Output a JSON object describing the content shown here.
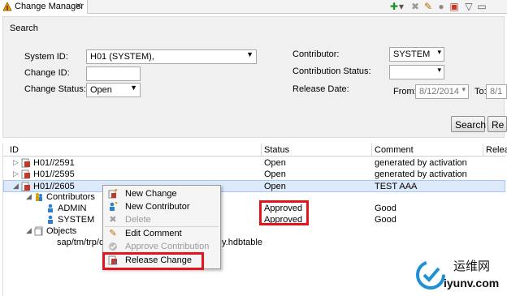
{
  "tab": {
    "title": "Change Manager",
    "close_glyph": "✕"
  },
  "toolbar": [
    {
      "name": "add-icon",
      "glyph": "✚",
      "color": "#1e8f2a"
    },
    {
      "name": "dropdown-icon",
      "glyph": "▾",
      "color": "#555"
    },
    {
      "name": "delete-icon",
      "glyph": "✖",
      "color": "#9a9a9a"
    },
    {
      "name": "edit-icon",
      "glyph": "✎",
      "color": "#b36b00"
    },
    {
      "name": "approve-icon",
      "glyph": "●",
      "color": "#8c8c8c"
    },
    {
      "name": "release-icon",
      "glyph": "▣",
      "color": "#c0392b"
    },
    {
      "name": "view-menu-icon",
      "glyph": "▽",
      "color": "#555"
    },
    {
      "name": "minimize-icon",
      "glyph": "▭",
      "color": "#555"
    }
  ],
  "search": {
    "title": "Search",
    "system_id_label": "System ID:",
    "system_id_value": "H01 (SYSTEM),",
    "change_id_label": "Change ID:",
    "change_id_value": "",
    "change_status_label": "Change Status:",
    "change_status_value": "Open",
    "contributor_label": "Contributor:",
    "contributor_value": "SYSTEM",
    "contribution_status_label": "Contribution Status:",
    "contribution_status_value": "",
    "release_date_label": "Release Date:",
    "from_label": "From:",
    "from_value": "8/12/2014",
    "to_label": "To:",
    "to_value": "8/1",
    "search_button": "Search",
    "reset_button": "Re"
  },
  "table": {
    "columns": [
      "ID",
      "Status",
      "Comment",
      "Relea"
    ],
    "rows": [
      {
        "id": "H01//2591",
        "status": "Open",
        "comment": "generated by activation"
      },
      {
        "id": "H01//2595",
        "status": "Open",
        "comment": "generated by activation"
      },
      {
        "id": "H01//2605",
        "status": "Open",
        "comment": "TEST AAA"
      }
    ],
    "contributors_label": "Contributors",
    "contributors": [
      {
        "name": "ADMIN",
        "status": "Approved",
        "comment": "Good"
      },
      {
        "name": "SYSTEM",
        "status": "Approved",
        "comment": "Good"
      }
    ],
    "objects_label": "Objects",
    "object_prefix": "sap/tm/trp/db",
    "object_suffix": "y.hdbtable"
  },
  "menu": {
    "items": [
      {
        "label": "New Change",
        "enabled": true,
        "icon": "new-change-icon"
      },
      {
        "label": "New Contributor",
        "enabled": true,
        "icon": "new-contributor-icon"
      },
      {
        "label": "Delete",
        "enabled": false,
        "icon": "delete-icon"
      },
      {
        "label": "Edit Comment",
        "enabled": true,
        "icon": "edit-comment-icon"
      },
      {
        "label": "Approve Contribution",
        "enabled": false,
        "icon": "approve-icon"
      },
      {
        "label": "Release Change",
        "enabled": true,
        "icon": "release-change-icon"
      }
    ]
  },
  "watermark": {
    "cn": "运维网",
    "url": "iyunv.com"
  },
  "colors": {
    "highlight_red": "#e3141b",
    "selection_bg": "#dbe9fb"
  }
}
